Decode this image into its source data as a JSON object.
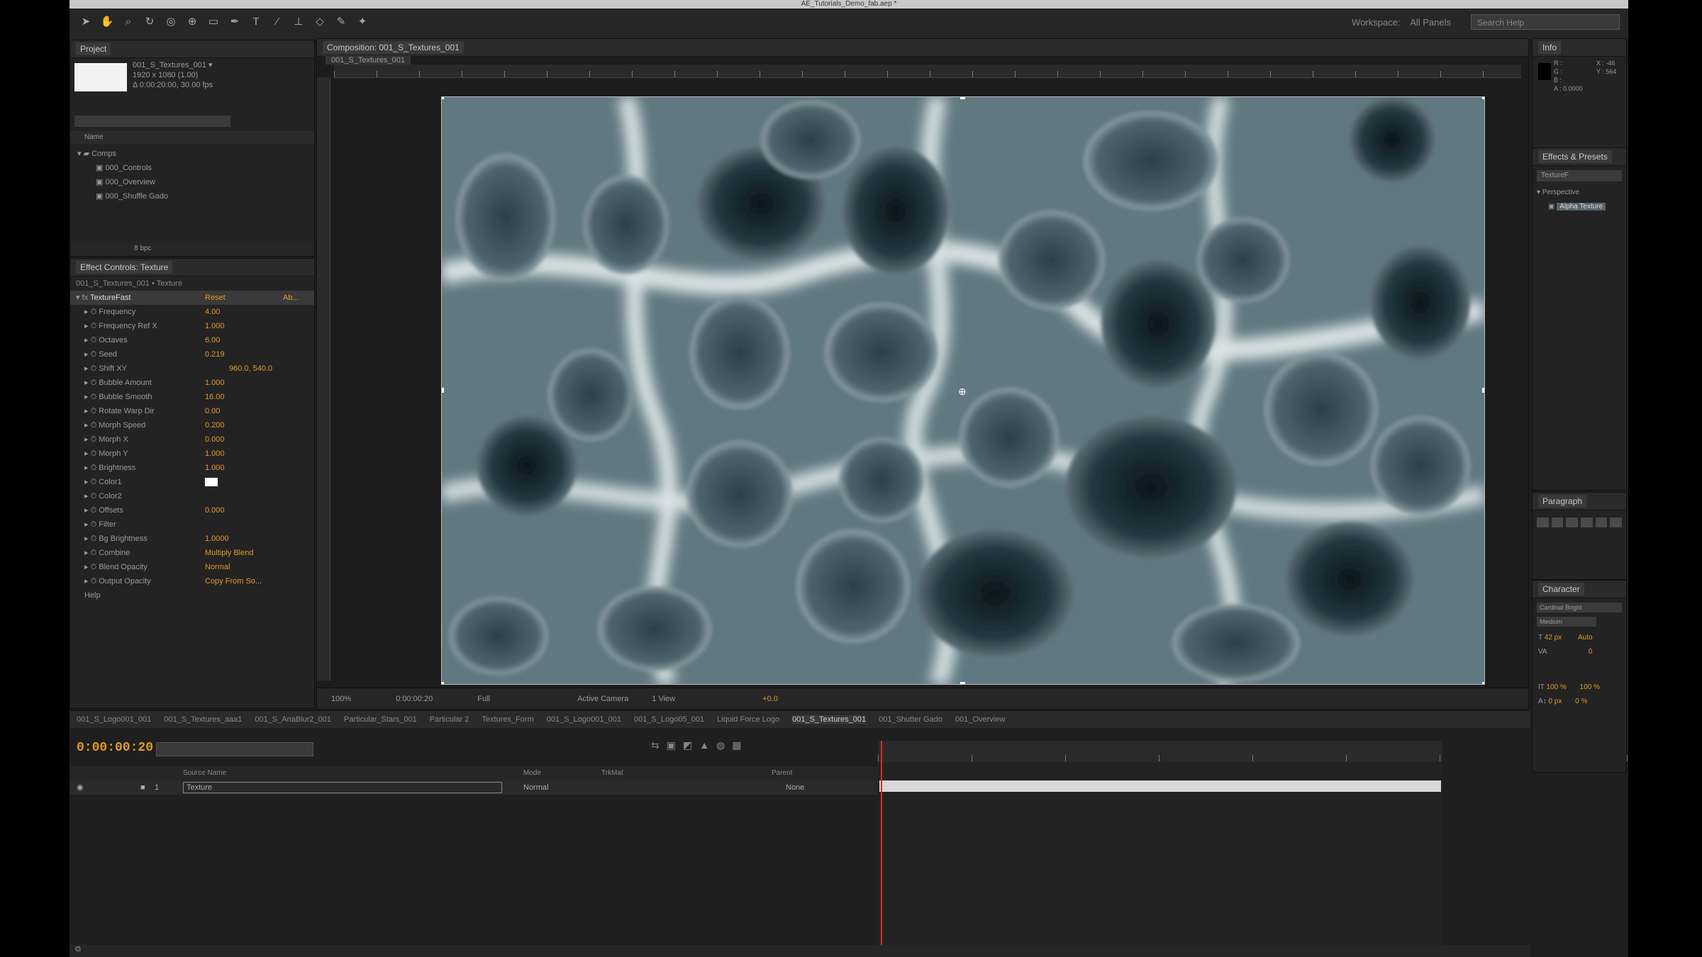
{
  "window": {
    "title": "AE_Tutorials_Demo_fab.aep *"
  },
  "toolbar": {
    "workspace_label": "Workspace:",
    "workspace_value": "All Panels",
    "search_placeholder": "Search Help"
  },
  "project": {
    "tab": "Project",
    "item_name": "001_S_Textures_001 ▾",
    "item_info_1": "1920 x 1080 (1.00)",
    "item_info_2": "Δ 0:00:20:00, 30.00 fps",
    "col_name": "Name",
    "items": [
      "Comps",
      "000_Controls",
      "000_Overview",
      "000_Shuffle Gado"
    ],
    "footer": "8 bpc"
  },
  "effect_controls": {
    "tab": "Effect Controls: Texture",
    "layer": "001_S_Textures_001 • Texture",
    "effect_name": "TextureFast",
    "reset": "Reset",
    "about": "Ab...",
    "params": [
      {
        "name": "Frequency",
        "value": "4.00"
      },
      {
        "name": "Frequency Ref X",
        "value": "1.000"
      },
      {
        "name": "Octaves",
        "value": "6.00"
      },
      {
        "name": "Seed",
        "value": "0.219"
      },
      {
        "name": "Shift XY",
        "value": "960.0, 540.0"
      },
      {
        "name": "Bubble Amount",
        "value": "1.000"
      },
      {
        "name": "Bubble Smooth",
        "value": "16.00"
      },
      {
        "name": "Rotate Warp Dir",
        "value": "0.00"
      },
      {
        "name": "Morph Speed",
        "value": "0.200"
      },
      {
        "name": "Morph X",
        "value": "0.000"
      },
      {
        "name": "Morph Y",
        "value": "1.000"
      },
      {
        "name": "Brightness",
        "value": "1.000"
      },
      {
        "name": "Color1",
        "value": ""
      },
      {
        "name": "Color2",
        "value": ""
      },
      {
        "name": "Offsets",
        "value": "0.000"
      },
      {
        "name": "Filter",
        "value": ""
      },
      {
        "name": "Bg Brightness",
        "value": "1.0000"
      },
      {
        "name": "Combine",
        "value": "Multiply Blend"
      },
      {
        "name": "Blend Opacity",
        "value": "Normal"
      },
      {
        "name": "Output Opacity",
        "value": "Copy From So..."
      },
      {
        "name": "Help",
        "value": ""
      }
    ]
  },
  "composition": {
    "tab": "Composition: 001_S_Textures_001",
    "subtab": "001_S_Textures_001",
    "footer_zoom": "100%",
    "footer_time": "0:00:00:20",
    "footer_quality": "Full",
    "footer_camera": "Active Camera",
    "footer_view": "1 View",
    "footer_exposure": "+0.0"
  },
  "timeline": {
    "tabs": [
      "001_S_Logo001_001",
      "001_S_Textures_aaa1",
      "001_S_AnaBlur2_001",
      "Particular_Stars_001",
      "Particular 2",
      "Textures_Form",
      "001_S_Logo001_001",
      "001_S_Logo05_001",
      "Liquid Force Logo",
      "001_S_Textures_001",
      "001_Shutter Gado",
      "001_Overview"
    ],
    "timecode": "0:00:00:20",
    "header_name": "Source Name",
    "header_mode": "Mode",
    "header_trkmat": "TrkMat",
    "header_parent": "Parent",
    "layer_number": "1",
    "layer_name": "Texture",
    "layer_mode": "Normal",
    "layer_parent": "None"
  },
  "right": {
    "info_tab": "Info",
    "info_lines": [
      "R :",
      "G :",
      "B :",
      "A : 0.0000",
      "X : -46",
      "Y : 564"
    ],
    "effects_tab": "Effects & Presets",
    "effects_search": "TextureF",
    "effects_category": "Perspective",
    "effects_item": "Alpha Texture",
    "paragraph_tab": "Paragraph",
    "character_tab": "Character",
    "font": "Cardinal Bright",
    "style": "Medium",
    "size": "42 px",
    "leading": "Auto",
    "tracking": "0",
    "scale_v": "100 %",
    "scale_h": "100 %",
    "baseline": "0 px",
    "tsume": "0 %"
  }
}
